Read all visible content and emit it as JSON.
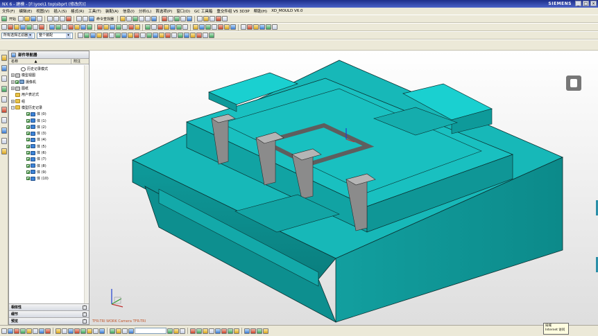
{
  "window": {
    "title": "NX 6 - 建模 - [F:\\yoo\\1 top\\sbprt (修改的)]",
    "brand": "SIEMENS",
    "controls": [
      "_",
      "□",
      "×"
    ]
  },
  "menu": [
    "文件(F)",
    "编辑(E)",
    "视图(V)",
    "插入(S)",
    "格式(R)",
    "工具(T)",
    "装配(A)",
    "信息(I)",
    "分析(L)",
    "首选项(P)",
    "窗口(O)",
    "GC 工具箱",
    "重交件组 V5 3D3P",
    "帮助(H)",
    "XD_MOULD V6.0"
  ],
  "toolbar1": {
    "start_label": "开始",
    "snap_label": "命令查找器"
  },
  "toolbar3": {
    "filter_value": "所有选择过滤器",
    "scope_value": "整个装配"
  },
  "navigator": {
    "title": "部件导航器",
    "col_name": "名称",
    "col_sort": "▲",
    "col_attr": "附注",
    "nodes": [
      {
        "label": "历史记录模式",
        "icon": "clock",
        "indent": 1,
        "exp": "",
        "check": false
      },
      {
        "label": "模型视图",
        "icon": "model",
        "indent": 0,
        "exp": "+",
        "check": false
      },
      {
        "label": "摄像机",
        "icon": "cam",
        "indent": 0,
        "exp": "+",
        "check": true
      },
      {
        "label": "图纸",
        "icon": "model",
        "indent": 0,
        "exp": "+",
        "check": false
      },
      {
        "label": "用户表达式",
        "icon": "folder",
        "indent": 0,
        "exp": "",
        "check": false
      },
      {
        "label": "组",
        "icon": "folder",
        "indent": 0,
        "exp": "+",
        "check": false
      },
      {
        "label": "模型历史记录",
        "icon": "folder",
        "indent": 0,
        "exp": "−",
        "check": false
      },
      {
        "label": "体 (0)",
        "icon": "body",
        "indent": 2,
        "exp": "",
        "check": true
      },
      {
        "label": "体 (1)",
        "icon": "body",
        "indent": 2,
        "exp": "",
        "check": true
      },
      {
        "label": "体 (2)",
        "icon": "body",
        "indent": 2,
        "exp": "",
        "check": true
      },
      {
        "label": "体 (3)",
        "icon": "body",
        "indent": 2,
        "exp": "",
        "check": true
      },
      {
        "label": "体 (4)",
        "icon": "body",
        "indent": 2,
        "exp": "",
        "check": true
      },
      {
        "label": "体 (5)",
        "icon": "body",
        "indent": 2,
        "exp": "",
        "check": true
      },
      {
        "label": "体 (6)",
        "icon": "body",
        "indent": 2,
        "exp": "",
        "check": true
      },
      {
        "label": "体 (7)",
        "icon": "body",
        "indent": 2,
        "exp": "",
        "check": true
      },
      {
        "label": "体 (8)",
        "icon": "body",
        "indent": 2,
        "exp": "",
        "check": true
      },
      {
        "label": "体 (9)",
        "icon": "body",
        "indent": 2,
        "exp": "",
        "check": true
      },
      {
        "label": "体 (10)",
        "icon": "body",
        "indent": 2,
        "exp": "",
        "check": true
      }
    ],
    "bottom_sections": [
      "相依性",
      "细节",
      "预览"
    ]
  },
  "viewport": {
    "status_text": "TFR-TRI WORK Camera TFR-TRI",
    "model_color": "#14b3b3",
    "triad_axes": [
      "X",
      "Y",
      "Z"
    ]
  },
  "statusbar": {
    "tooltip_line1": "局域",
    "tooltip_line2": "Internet 访问"
  }
}
